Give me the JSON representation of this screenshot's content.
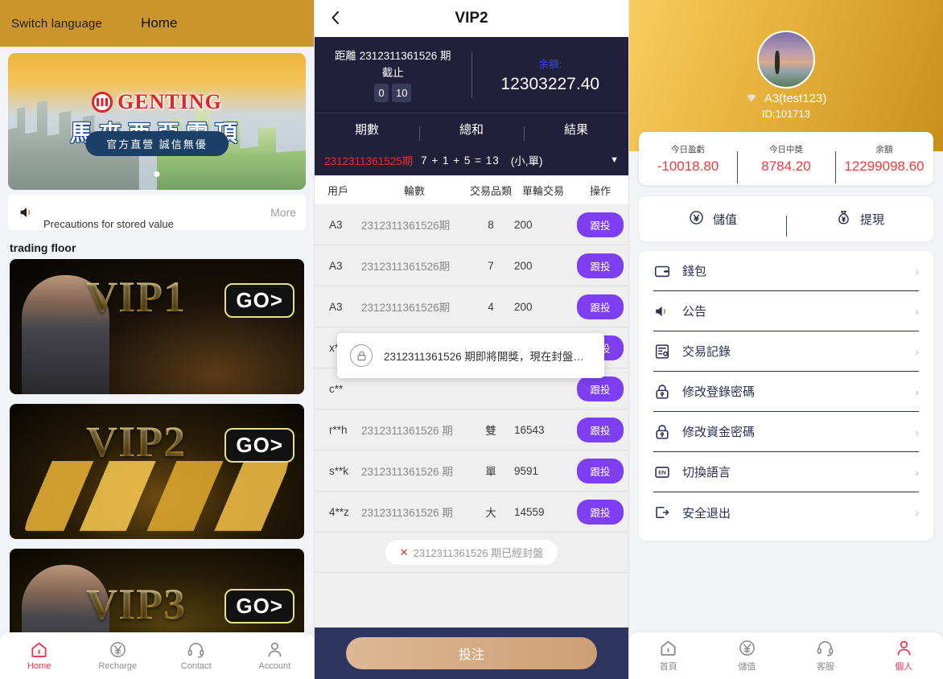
{
  "left": {
    "topbar": {
      "switch_language": "Switch language",
      "home": "Home"
    },
    "banner": {
      "brand": "GENTING",
      "cn_title": "馬來西亞雲頂",
      "pill": "官方直營 誠信無優"
    },
    "notice": {
      "text": "Precautions for stored value",
      "more": "More"
    },
    "section_title": "trading floor",
    "vip_cards": [
      {
        "label": "VIP1",
        "go": "GO>"
      },
      {
        "label": "VIP2",
        "go": "GO>"
      },
      {
        "label": "VIP3",
        "go": "GO>"
      }
    ],
    "bottom_nav": [
      {
        "label": "Home",
        "icon": "home-icon",
        "active": true
      },
      {
        "label": "Recharge",
        "icon": "yen-icon",
        "active": false
      },
      {
        "label": "Contact",
        "icon": "headset-icon",
        "active": false
      },
      {
        "label": "Account",
        "icon": "person-icon",
        "active": false
      }
    ]
  },
  "middle": {
    "title": "VIP2",
    "back_icon": "chevron-left-icon",
    "countdown": {
      "line1": "距離 2312311361526 期",
      "line2": "截止",
      "digit1": "0",
      "digit2": "10"
    },
    "balance": {
      "label": "余額:",
      "value": "12303227.40"
    },
    "tabs": [
      "期數",
      "總和",
      "結果"
    ],
    "result": {
      "period": "2312311361525期",
      "sum": "7 + 1 + 5 = 13",
      "tag": "(小,單)",
      "caret": "▼"
    },
    "table": {
      "headers": [
        "用戶",
        "輪數",
        "交易品類",
        "單輪交易",
        "操作"
      ],
      "rows": [
        {
          "user": "A3",
          "round": "2312311361526期",
          "type": "8",
          "amount": "200",
          "action": "跟投"
        },
        {
          "user": "A3",
          "round": "2312311361526期",
          "type": "7",
          "amount": "200",
          "action": "跟投"
        },
        {
          "user": "A3",
          "round": "2312311361526期",
          "type": "4",
          "amount": "200",
          "action": "跟投"
        },
        {
          "user": "x**",
          "round": "",
          "type": "",
          "amount": "",
          "action": "跟投"
        },
        {
          "user": "c**",
          "round": "",
          "type": "",
          "amount": "",
          "action": "跟投"
        },
        {
          "user": "r**h",
          "round": "2312311361526 期",
          "type": "雙",
          "amount": "16543",
          "action": "跟投"
        },
        {
          "user": "s**k",
          "round": "2312311361526 期",
          "type": "單",
          "amount": "9591",
          "action": "跟投"
        },
        {
          "user": "4**z",
          "round": "2312311361526 期",
          "type": "大",
          "amount": "14559",
          "action": "跟投"
        }
      ]
    },
    "closed_notice": {
      "x": "✕",
      "text": "2312311361526 期已經封盤"
    },
    "toast": {
      "icon": "lock-icon",
      "text": "2312311361526 期即將開獎，現在封盤…"
    },
    "bet_button": "投注"
  },
  "right": {
    "profile": {
      "name": "A3(test123)",
      "gem_icon": "gem-icon",
      "id": "ID:101713"
    },
    "stats": [
      {
        "label": "今日盈虧",
        "value": "-10018.80"
      },
      {
        "label": "今日中獎",
        "value": "8784.20"
      },
      {
        "label": "余額",
        "value": "12299098.60"
      }
    ],
    "actions": [
      {
        "label": "儲值",
        "icon": "yen-circle-icon"
      },
      {
        "label": "提現",
        "icon": "money-bag-icon"
      }
    ],
    "menu": [
      {
        "label": "錢包",
        "icon": "wallet-icon",
        "chev": "›"
      },
      {
        "label": "公告",
        "icon": "speaker-icon",
        "chev": "›"
      },
      {
        "label": "交易記錄",
        "icon": "record-icon",
        "chev": "›"
      },
      {
        "label": "修改登錄密碼",
        "icon": "lock-icon",
        "chev": "›"
      },
      {
        "label": "修改資金密碼",
        "icon": "lock-icon",
        "chev": "›"
      },
      {
        "label": "切換語言",
        "icon": "language-icon",
        "chev": "›"
      },
      {
        "label": "安全退出",
        "icon": "logout-icon",
        "chev": "›"
      }
    ],
    "bottom_nav": [
      {
        "label": "首頁",
        "icon": "home-icon",
        "active": false
      },
      {
        "label": "儲值",
        "icon": "yen-icon",
        "active": false
      },
      {
        "label": "客服",
        "icon": "headset-icon",
        "active": false
      },
      {
        "label": "個人",
        "icon": "person-icon",
        "active": true
      }
    ]
  },
  "colors": {
    "left_topbar": "#c9952c",
    "mid_dark": "#211f3a",
    "accent_purple": "#7e3ff2",
    "accent_red": "#f1304a",
    "gold": "#e8b53f",
    "bet_gold": "#cf9f74",
    "footer_navy": "#2e3660"
  }
}
